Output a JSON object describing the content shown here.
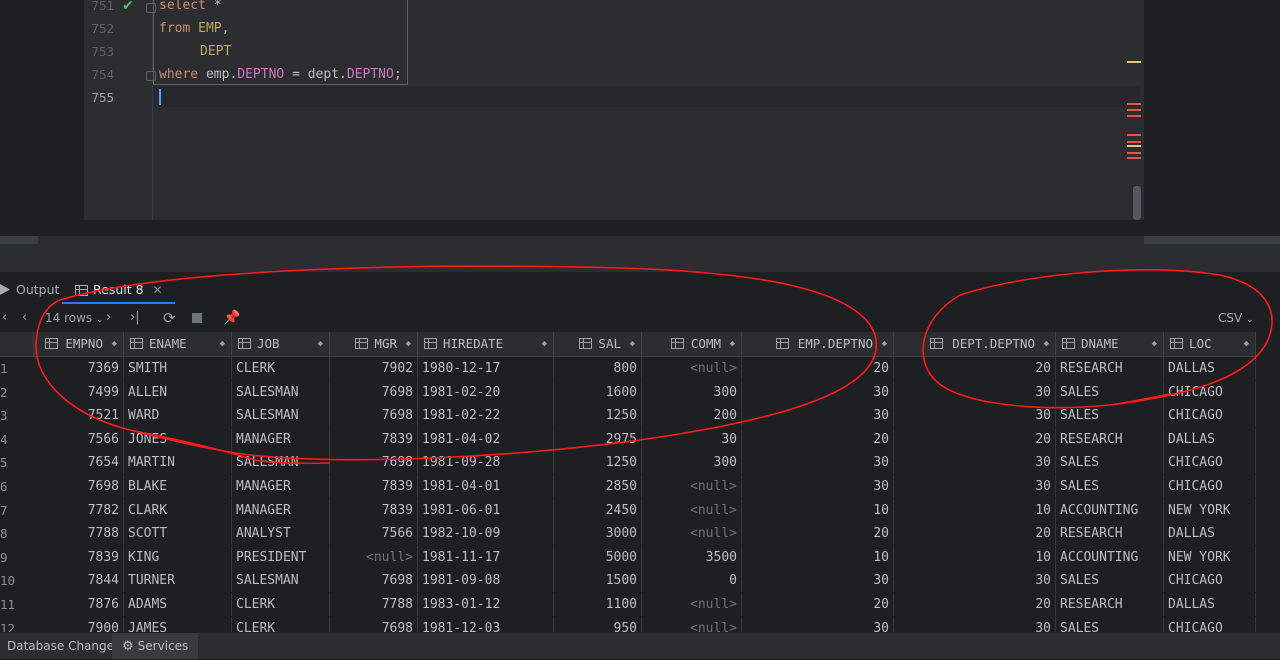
{
  "editor": {
    "line_numbers": [
      "751",
      "752",
      "753",
      "754",
      "755"
    ],
    "code": {
      "l1": {
        "kw": "select",
        "rest": " *"
      },
      "l2": {
        "kw": "from",
        "table": "EMP",
        "punct": ","
      },
      "l3": {
        "table": "DEPT"
      },
      "l4": {
        "kw": "where",
        "a": "emp",
        "dot1": ".",
        "f1": "DEPTNO",
        "eq": " = ",
        "b": "dept",
        "dot2": ".",
        "f2": "DEPTNO",
        "semi": ";"
      }
    }
  },
  "tabs": {
    "output": "Output",
    "result": "Result 8"
  },
  "toolbar": {
    "rows_label": "14 rows",
    "export_format": "CSV"
  },
  "grid": {
    "columns": [
      "EMPNO",
      "ENAME",
      "JOB",
      "MGR",
      "HIREDATE",
      "SAL",
      "COMM",
      "EMP.DEPTNO",
      "DEPT.DEPTNO",
      "DNAME",
      "LOC"
    ],
    "null_text": "<null>",
    "rows": [
      [
        "1",
        "7369",
        "SMITH",
        "CLERK",
        "7902",
        "1980-12-17",
        "800",
        "<null>",
        "20",
        "20",
        "RESEARCH",
        "DALLAS"
      ],
      [
        "2",
        "7499",
        "ALLEN",
        "SALESMAN",
        "7698",
        "1981-02-20",
        "1600",
        "300",
        "30",
        "30",
        "SALES",
        "CHICAGO"
      ],
      [
        "3",
        "7521",
        "WARD",
        "SALESMAN",
        "7698",
        "1981-02-22",
        "1250",
        "200",
        "30",
        "30",
        "SALES",
        "CHICAGO"
      ],
      [
        "4",
        "7566",
        "JONES",
        "MANAGER",
        "7839",
        "1981-04-02",
        "2975",
        "30",
        "20",
        "20",
        "RESEARCH",
        "DALLAS"
      ],
      [
        "5",
        "7654",
        "MARTIN",
        "SALESMAN",
        "7698",
        "1981-09-28",
        "1250",
        "300",
        "30",
        "30",
        "SALES",
        "CHICAGO"
      ],
      [
        "6",
        "7698",
        "BLAKE",
        "MANAGER",
        "7839",
        "1981-04-01",
        "2850",
        "<null>",
        "30",
        "30",
        "SALES",
        "CHICAGO"
      ],
      [
        "7",
        "7782",
        "CLARK",
        "MANAGER",
        "7839",
        "1981-06-01",
        "2450",
        "<null>",
        "10",
        "10",
        "ACCOUNTING",
        "NEW YORK"
      ],
      [
        "8",
        "7788",
        "SCOTT",
        "ANALYST",
        "7566",
        "1982-10-09",
        "3000",
        "<null>",
        "20",
        "20",
        "RESEARCH",
        "DALLAS"
      ],
      [
        "9",
        "7839",
        "KING",
        "PRESIDENT",
        "<null>",
        "1981-11-17",
        "5000",
        "3500",
        "10",
        "10",
        "ACCOUNTING",
        "NEW YORK"
      ],
      [
        "10",
        "7844",
        "TURNER",
        "SALESMAN",
        "7698",
        "1981-09-08",
        "1500",
        "0",
        "30",
        "30",
        "SALES",
        "CHICAGO"
      ],
      [
        "11",
        "7876",
        "ADAMS",
        "CLERK",
        "7788",
        "1983-01-12",
        "1100",
        "<null>",
        "20",
        "20",
        "RESEARCH",
        "DALLAS"
      ],
      [
        "12",
        "7900",
        "JAMES",
        "CLERK",
        "7698",
        "1981-12-03",
        "950",
        "<null>",
        "30",
        "30",
        "SALES",
        "CHICAGO"
      ]
    ]
  },
  "bottom": {
    "db_changes": "Database Changes",
    "services": "Services"
  },
  "colors": {
    "accent": "#3574f0",
    "annotation": "#ff1a1a",
    "keyword": "#cf8e6d",
    "field": "#c77dbb"
  },
  "icons": [
    "check-icon",
    "table-icon",
    "prev-page-icon",
    "next-page-icon",
    "last-page-icon",
    "refresh-icon",
    "stop-icon",
    "pin-icon",
    "close-icon",
    "chevron-down-icon",
    "services-icon",
    "output-icon"
  ]
}
